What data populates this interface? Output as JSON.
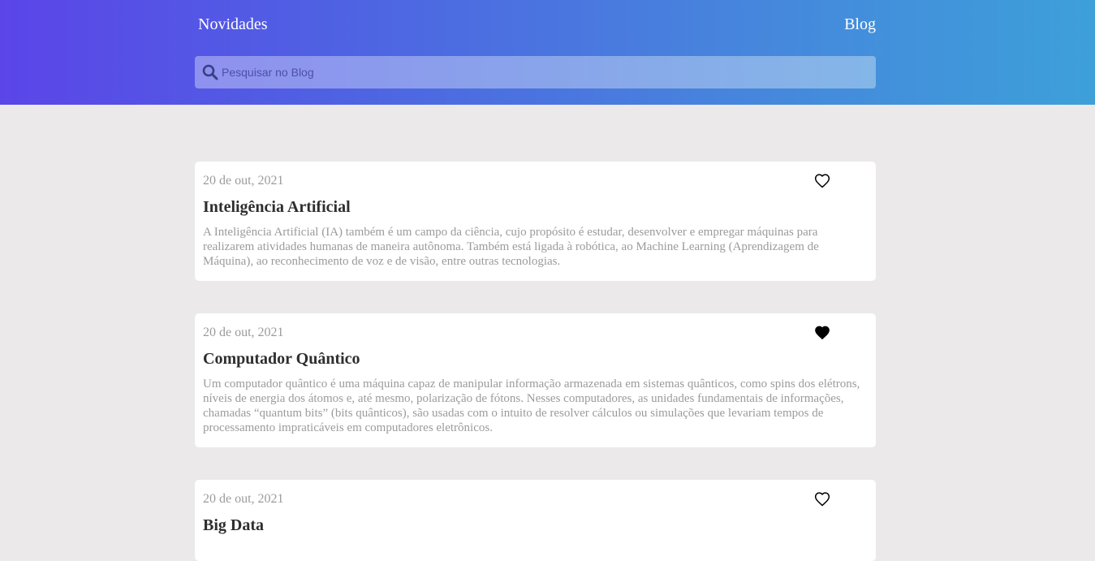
{
  "nav": {
    "left_label": "Novidades",
    "right_label": "Blog"
  },
  "search": {
    "placeholder": "Pesquisar no Blog",
    "value": ""
  },
  "posts": [
    {
      "date": "20 de out, 2021",
      "title": "Inteligência Artificial",
      "text": "A Inteligência Artificial (IA) também é um campo da ciência, cujo propósito é estudar, desenvolver e empregar máquinas para realizarem atividades humanas de maneira autônoma. Também está ligada à robótica, ao Machine Learning (Aprendizagem de Máquina), ao reconhecimento de voz e de visão, entre outras tecnologias.",
      "liked": false
    },
    {
      "date": "20 de out, 2021",
      "title": "Computador Quântico",
      "text": "Um computador quântico é uma máquina capaz de manipular informação armazenada em sistemas quânticos, como spins dos elétrons, níveis de energia dos átomos e, até mesmo, polarização de fótons. Nesses computadores, as unidades fundamentais de informações, chamadas “quantum bits” (bits quânticos), são usadas com o intuito de resolver cálculos ou simulações que levariam tempos de processamento impraticáveis em computadores eletrônicos.",
      "liked": true
    },
    {
      "date": "20 de out, 2021",
      "title": "Big Data",
      "text": "",
      "liked": false
    }
  ],
  "colors": {
    "header_gradient_start": "#5b45e8",
    "header_gradient_end": "#3da0d9",
    "background": "#ebe9ea",
    "card": "#ffffff",
    "muted_text": "#9b9b9b",
    "title_text": "#2e2e2e"
  },
  "icons": {
    "search": "search-icon",
    "like": "heart-icon"
  }
}
